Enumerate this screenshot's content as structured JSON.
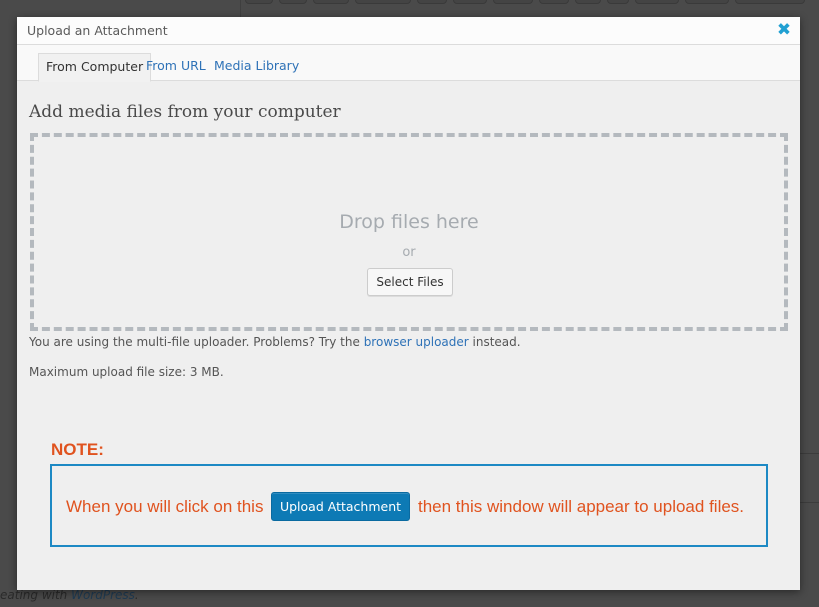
{
  "background": {
    "footer_prefix": "eating with ",
    "footer_link": "WordPress",
    "footer_suffix": "."
  },
  "dialog": {
    "title": "Upload an Attachment",
    "close_icon": "close-x-icon",
    "tabs": [
      {
        "label": "From Computer",
        "active": true
      },
      {
        "label": "From URL",
        "active": false
      },
      {
        "label": "Media Library",
        "active": false
      }
    ],
    "heading": "Add media files from your computer",
    "dropzone": {
      "drop_text": "Drop files here",
      "or_text": "or",
      "select_button": "Select Files"
    },
    "uploader_notice": {
      "prefix": "You are using the multi-file uploader. Problems? Try the ",
      "link": "browser uploader",
      "suffix": " instead."
    },
    "max_size": "Maximum upload file size: 3 MB."
  },
  "annotation": {
    "label": "NOTE:",
    "text_before": "When you will click on this",
    "button_label": "Upload Attachment",
    "text_after": "then this window will appear to upload files.",
    "colors": {
      "text": "#e0531f",
      "border": "#1d89c4",
      "button": "#0d7ab5"
    }
  },
  "colors": {
    "accent": "#2e72b7",
    "close": "#21a0d2",
    "overlay": "#4a4a4a"
  }
}
